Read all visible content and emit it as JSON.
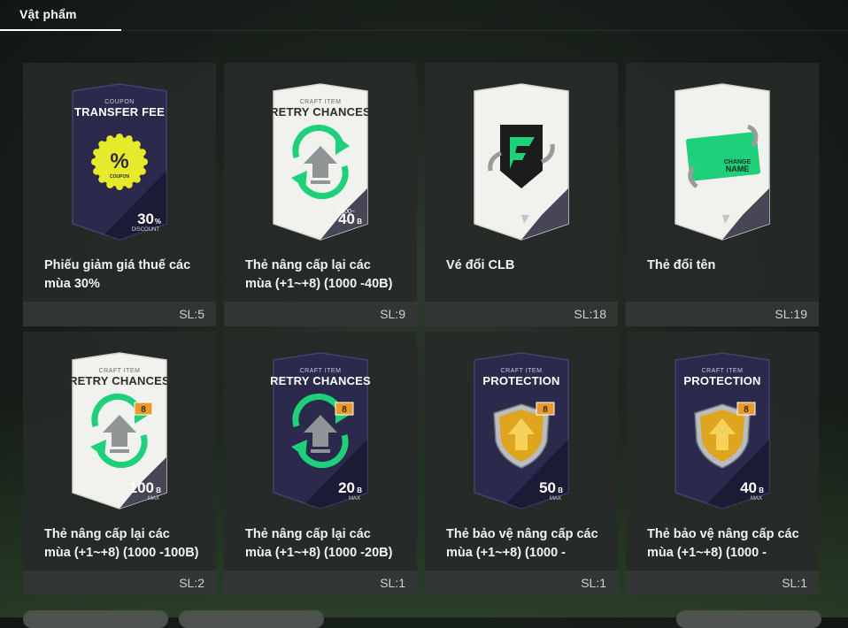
{
  "header": {
    "tab_label": "Vật phẩm"
  },
  "items": [
    {
      "name": "Phiếu giảm giá thuế các mùa 30%",
      "qty": "SL:5",
      "card": {
        "style": "dark",
        "top": "COUPON",
        "title": "TRANSFER FEE",
        "badge": "%",
        "badge_sub": "COUPON",
        "big": "30",
        "unit": "%",
        "sub": "DISCOUNT",
        "icon": "coupon-icon"
      }
    },
    {
      "name": "Thẻ nâng cấp lại các mùa (+1~+8) (1000 -40B)",
      "qty": "SL:9",
      "card": {
        "style": "light",
        "top": "CRAFT ITEM",
        "title": "RETRY CHANCES",
        "pre": "1000~",
        "big": "40",
        "unit": "B",
        "icon": "retry-arrows-icon"
      }
    },
    {
      "name": "Vé đổi CLB",
      "qty": "SL:18",
      "card": {
        "style": "light",
        "icon": "club-swap-icon"
      }
    },
    {
      "name": "Thẻ đổi tên",
      "qty": "SL:19",
      "card": {
        "style": "light",
        "label1": "CHANGE",
        "label2": "NAME",
        "icon": "name-change-icon"
      }
    },
    {
      "name": "Thẻ nâng cấp lại các mùa (+1~+8) (1000 -100B)",
      "qty": "SL:2",
      "card": {
        "style": "light",
        "top": "CRAFT ITEM",
        "title": "RETRY CHANCES",
        "chip": "8",
        "big": "100",
        "unit": "B",
        "sub": "MAX",
        "icon": "retry-arrows-icon"
      }
    },
    {
      "name": "Thẻ nâng cấp lại các mùa (+1~+8) (1000 -20B)",
      "qty": "SL:1",
      "card": {
        "style": "dark",
        "top": "CRAFT ITEM",
        "title": "RETRY CHANCES",
        "chip": "8",
        "big": "20",
        "unit": "B",
        "sub": "MAX",
        "icon": "retry-arrows-icon"
      }
    },
    {
      "name": "Thẻ bảo vệ nâng cấp các mùa (+1~+8) (1000 -",
      "qty": "SL:1",
      "card": {
        "style": "dark",
        "top": "CRAFT ITEM",
        "title": "PROTECTION",
        "chip": "8",
        "big": "50",
        "unit": "B",
        "sub": "MAX",
        "icon": "shield-icon"
      }
    },
    {
      "name": "Thẻ bảo vệ nâng cấp các mùa (+1~+8) (1000 -",
      "qty": "SL:1",
      "card": {
        "style": "dark",
        "top": "CRAFT ITEM",
        "title": "PROTECTION",
        "chip": "8",
        "big": "40",
        "unit": "B",
        "sub": "MAX",
        "icon": "shield-icon"
      }
    }
  ],
  "colors": {
    "dark_card": "#2b2a4d",
    "light_card": "#f1f1ee",
    "accent_green": "#1fd07a",
    "badge_yellow": "#e6ea2a",
    "shield_gold": "#e0a51e",
    "chip_orange": "#e89a2c"
  }
}
